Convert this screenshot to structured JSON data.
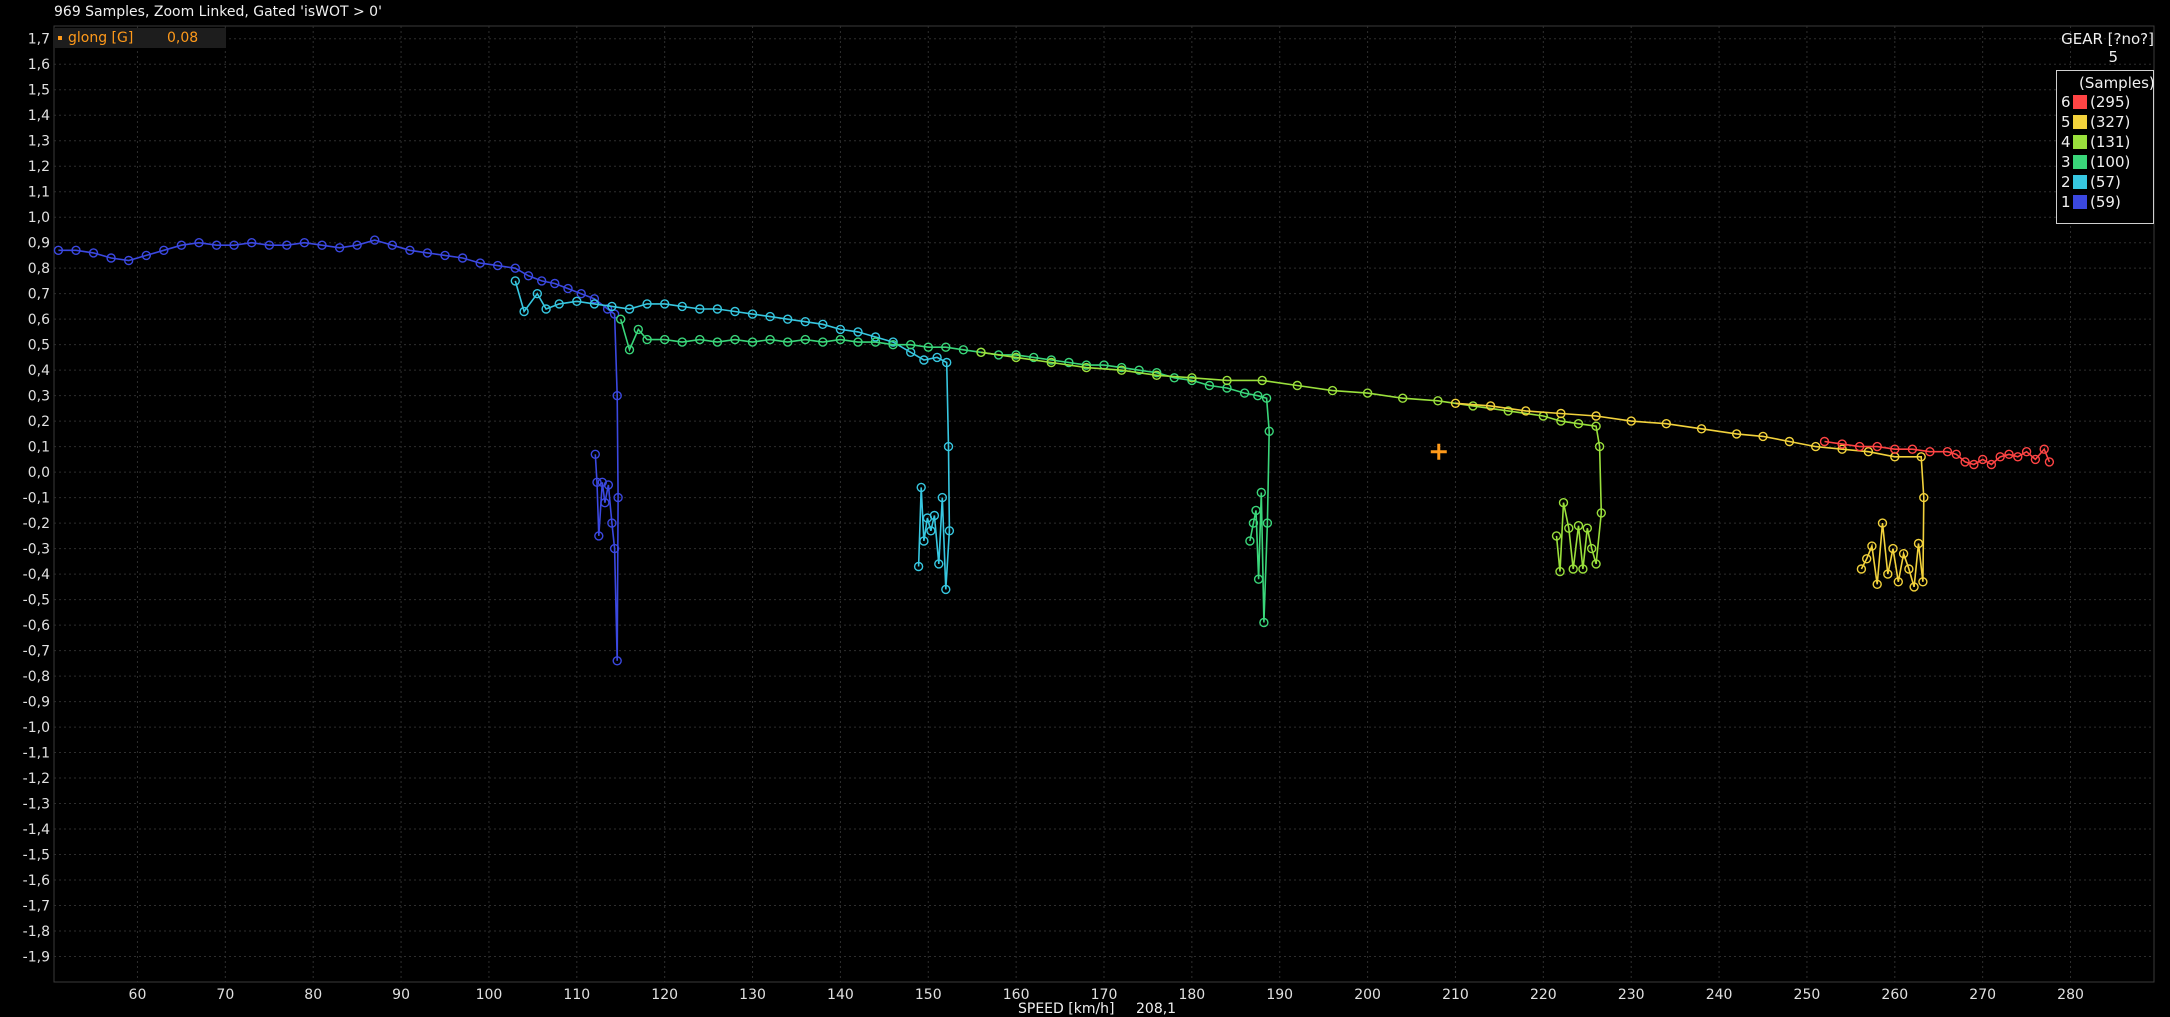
{
  "header": {
    "status": "969 Samples, Zoom Linked, Gated 'isWOT > 0'"
  },
  "cursor": {
    "channel": "glong [G]",
    "value": "0,08",
    "x": 208.1,
    "y": 0.08
  },
  "legend": {
    "title": "GEAR [?no?]",
    "current": "5",
    "subtitle": "(Samples)",
    "items": [
      {
        "gear": "6",
        "count": "(295)",
        "color": "#ff4444"
      },
      {
        "gear": "5",
        "count": "(327)",
        "color": "#f2d23c"
      },
      {
        "gear": "4",
        "count": "(131)",
        "color": "#9ae03c"
      },
      {
        "gear": "3",
        "count": "(100)",
        "color": "#3ad67a"
      },
      {
        "gear": "2",
        "count": "(57)",
        "color": "#37c7e0"
      },
      {
        "gear": "1",
        "count": "(59)",
        "color": "#3b48e0"
      }
    ]
  },
  "chart_data": {
    "type": "scatter",
    "xlabel": "SPEED [km/h]",
    "x_readout": "208,1",
    "ylabel": "glong [G]",
    "xlim": [
      50.5,
      289.5
    ],
    "ylim": [
      -2.0,
      1.75
    ],
    "grid": true,
    "legend_placement": "top-right",
    "x_ticks": [
      60,
      70,
      80,
      90,
      100,
      110,
      120,
      130,
      140,
      150,
      160,
      170,
      180,
      190,
      200,
      210,
      220,
      230,
      240,
      250,
      260,
      270,
      280
    ],
    "y_ticks": [
      "1,7",
      "1,6",
      "1,5",
      "1,4",
      "1,3",
      "1,2",
      "1,1",
      "1,0",
      "0,9",
      "0,8",
      "0,7",
      "0,6",
      "0,5",
      "0,4",
      "0,3",
      "0,2",
      "0,1",
      "0,0",
      "-0,1",
      "-0,2",
      "-0,3",
      "-0,4",
      "-0,5",
      "-0,6",
      "-0,7",
      "-0,8",
      "-0,9",
      "-1,0",
      "-1,1",
      "-1,2",
      "-1,3",
      "-1,4",
      "-1,5",
      "-1,6",
      "-1,7",
      "-1,8",
      "-1,9"
    ],
    "series": [
      {
        "name": "1",
        "color": "#3b48e0",
        "points": [
          [
            51,
            0.87
          ],
          [
            53,
            0.87
          ],
          [
            55,
            0.86
          ],
          [
            57,
            0.84
          ],
          [
            59,
            0.83
          ],
          [
            61,
            0.85
          ],
          [
            63,
            0.87
          ],
          [
            65,
            0.89
          ],
          [
            67,
            0.9
          ],
          [
            69,
            0.89
          ],
          [
            71,
            0.89
          ],
          [
            73,
            0.9
          ],
          [
            75,
            0.89
          ],
          [
            77,
            0.89
          ],
          [
            79,
            0.9
          ],
          [
            81,
            0.89
          ],
          [
            83,
            0.88
          ],
          [
            85,
            0.89
          ],
          [
            87,
            0.91
          ],
          [
            89,
            0.89
          ],
          [
            91,
            0.87
          ],
          [
            93,
            0.86
          ],
          [
            95,
            0.85
          ],
          [
            97,
            0.84
          ],
          [
            99,
            0.82
          ],
          [
            101,
            0.81
          ],
          [
            103,
            0.8
          ],
          [
            104.5,
            0.77
          ],
          [
            106,
            0.75
          ],
          [
            107.5,
            0.74
          ],
          [
            109,
            0.72
          ],
          [
            110.5,
            0.7
          ],
          [
            112,
            0.68
          ],
          [
            113.5,
            0.64
          ],
          [
            114.3,
            0.62
          ],
          [
            114.6,
            0.3
          ],
          [
            114.7,
            -0.1
          ],
          [
            114.6,
            -0.74
          ],
          [
            114.3,
            -0.3
          ],
          [
            114.0,
            -0.2
          ],
          [
            113.6,
            -0.05
          ],
          [
            113.2,
            -0.12
          ],
          [
            112.9,
            -0.04
          ],
          [
            112.5,
            -0.25
          ],
          [
            112.3,
            -0.04
          ],
          [
            112.1,
            0.07
          ]
        ]
      },
      {
        "name": "2",
        "color": "#37c7e0",
        "points": [
          [
            103,
            0.75
          ],
          [
            104,
            0.63
          ],
          [
            105.5,
            0.7
          ],
          [
            106.5,
            0.64
          ],
          [
            108,
            0.66
          ],
          [
            110,
            0.67
          ],
          [
            112,
            0.66
          ],
          [
            114,
            0.65
          ],
          [
            116,
            0.64
          ],
          [
            118,
            0.66
          ],
          [
            120,
            0.66
          ],
          [
            122,
            0.65
          ],
          [
            124,
            0.64
          ],
          [
            126,
            0.64
          ],
          [
            128,
            0.63
          ],
          [
            130,
            0.62
          ],
          [
            132,
            0.61
          ],
          [
            134,
            0.6
          ],
          [
            136,
            0.59
          ],
          [
            138,
            0.58
          ],
          [
            140,
            0.56
          ],
          [
            142,
            0.55
          ],
          [
            144,
            0.53
          ],
          [
            146,
            0.51
          ],
          [
            148,
            0.47
          ],
          [
            149.5,
            0.44
          ],
          [
            151,
            0.45
          ],
          [
            152.1,
            0.43
          ],
          [
            152.3,
            0.1
          ],
          [
            152.4,
            -0.23
          ],
          [
            152.0,
            -0.46
          ],
          [
            151.6,
            -0.1
          ],
          [
            151.2,
            -0.36
          ],
          [
            150.7,
            -0.17
          ],
          [
            150.3,
            -0.23
          ],
          [
            149.9,
            -0.18
          ],
          [
            149.5,
            -0.27
          ],
          [
            149.2,
            -0.06
          ],
          [
            148.9,
            -0.37
          ]
        ]
      },
      {
        "name": "3",
        "color": "#3ad67a",
        "points": [
          [
            115,
            0.6
          ],
          [
            116,
            0.48
          ],
          [
            117,
            0.56
          ],
          [
            118,
            0.52
          ],
          [
            120,
            0.52
          ],
          [
            122,
            0.51
          ],
          [
            124,
            0.52
          ],
          [
            126,
            0.51
          ],
          [
            128,
            0.52
          ],
          [
            130,
            0.51
          ],
          [
            132,
            0.52
          ],
          [
            134,
            0.51
          ],
          [
            136,
            0.52
          ],
          [
            138,
            0.51
          ],
          [
            140,
            0.52
          ],
          [
            142,
            0.51
          ],
          [
            144,
            0.51
          ],
          [
            146,
            0.5
          ],
          [
            148,
            0.5
          ],
          [
            150,
            0.49
          ],
          [
            152,
            0.49
          ],
          [
            154,
            0.48
          ],
          [
            156,
            0.47
          ],
          [
            158,
            0.46
          ],
          [
            160,
            0.46
          ],
          [
            162,
            0.45
          ],
          [
            164,
            0.44
          ],
          [
            166,
            0.43
          ],
          [
            168,
            0.42
          ],
          [
            170,
            0.42
          ],
          [
            172,
            0.41
          ],
          [
            174,
            0.4
          ],
          [
            176,
            0.39
          ],
          [
            178,
            0.37
          ],
          [
            180,
            0.36
          ],
          [
            182,
            0.34
          ],
          [
            184,
            0.33
          ],
          [
            186,
            0.31
          ],
          [
            187.5,
            0.3
          ],
          [
            188.5,
            0.29
          ],
          [
            188.8,
            0.16
          ],
          [
            188.6,
            -0.2
          ],
          [
            188.2,
            -0.59
          ],
          [
            187.9,
            -0.08
          ],
          [
            187.6,
            -0.42
          ],
          [
            187.3,
            -0.15
          ],
          [
            187.0,
            -0.2
          ],
          [
            186.6,
            -0.27
          ]
        ]
      },
      {
        "name": "4",
        "color": "#9ae03c",
        "points": [
          [
            156,
            0.47
          ],
          [
            160,
            0.45
          ],
          [
            164,
            0.43
          ],
          [
            168,
            0.41
          ],
          [
            172,
            0.4
          ],
          [
            176,
            0.38
          ],
          [
            180,
            0.37
          ],
          [
            184,
            0.36
          ],
          [
            188,
            0.36
          ],
          [
            192,
            0.34
          ],
          [
            196,
            0.32
          ],
          [
            200,
            0.31
          ],
          [
            204,
            0.29
          ],
          [
            208,
            0.28
          ],
          [
            212,
            0.26
          ],
          [
            216,
            0.24
          ],
          [
            220,
            0.22
          ],
          [
            222,
            0.2
          ],
          [
            224,
            0.19
          ],
          [
            226,
            0.18
          ],
          [
            226.4,
            0.1
          ],
          [
            226.6,
            -0.16
          ],
          [
            226.0,
            -0.36
          ],
          [
            225.5,
            -0.3
          ],
          [
            225.0,
            -0.22
          ],
          [
            224.5,
            -0.38
          ],
          [
            224.0,
            -0.21
          ],
          [
            223.4,
            -0.38
          ],
          [
            222.9,
            -0.22
          ],
          [
            222.3,
            -0.12
          ],
          [
            221.9,
            -0.39
          ],
          [
            221.5,
            -0.25
          ]
        ]
      },
      {
        "name": "5",
        "color": "#f2d23c",
        "points": [
          [
            210,
            0.27
          ],
          [
            214,
            0.26
          ],
          [
            218,
            0.24
          ],
          [
            222,
            0.23
          ],
          [
            226,
            0.22
          ],
          [
            230,
            0.2
          ],
          [
            234,
            0.19
          ],
          [
            238,
            0.17
          ],
          [
            242,
            0.15
          ],
          [
            245,
            0.14
          ],
          [
            248,
            0.12
          ],
          [
            251,
            0.1
          ],
          [
            254,
            0.09
          ],
          [
            257,
            0.08
          ],
          [
            260,
            0.06
          ],
          [
            263,
            0.06
          ],
          [
            263.3,
            -0.1
          ],
          [
            263.2,
            -0.43
          ],
          [
            262.7,
            -0.28
          ],
          [
            262.2,
            -0.45
          ],
          [
            261.6,
            -0.38
          ],
          [
            261.0,
            -0.32
          ],
          [
            260.4,
            -0.43
          ],
          [
            259.8,
            -0.3
          ],
          [
            259.2,
            -0.4
          ],
          [
            258.6,
            -0.2
          ],
          [
            258.0,
            -0.44
          ],
          [
            257.4,
            -0.29
          ],
          [
            256.8,
            -0.34
          ],
          [
            256.2,
            -0.38
          ]
        ]
      },
      {
        "name": "6",
        "color": "#ff4444",
        "points": [
          [
            252,
            0.12
          ],
          [
            254,
            0.11
          ],
          [
            256,
            0.1
          ],
          [
            258,
            0.1
          ],
          [
            260,
            0.09
          ],
          [
            262,
            0.09
          ],
          [
            264,
            0.08
          ],
          [
            266,
            0.08
          ],
          [
            267,
            0.07
          ],
          [
            268,
            0.04
          ],
          [
            269,
            0.03
          ],
          [
            270,
            0.05
          ],
          [
            271,
            0.03
          ],
          [
            272,
            0.06
          ],
          [
            273,
            0.07
          ],
          [
            274,
            0.06
          ],
          [
            275,
            0.08
          ],
          [
            276,
            0.05
          ],
          [
            277,
            0.09
          ],
          [
            277.6,
            0.04
          ]
        ]
      }
    ]
  }
}
